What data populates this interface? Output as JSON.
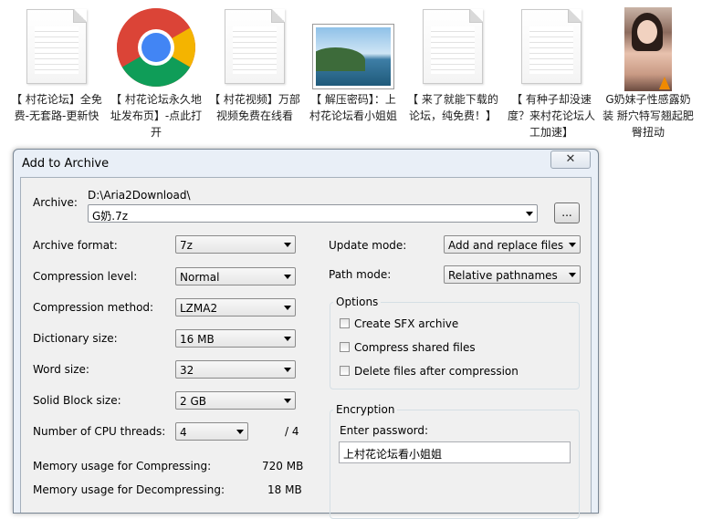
{
  "desktop": {
    "icons": [
      {
        "label": "【 村花论坛】全免费-无套路-更新快",
        "icon": "text-file-icon"
      },
      {
        "label": "【 村花论坛永久地址发布页】-点此打开",
        "icon": "chrome-icon"
      },
      {
        "label": "【 村花视频】万部视频免费在线看",
        "icon": "text-file-icon"
      },
      {
        "label": "【 解压密码】：上村花论坛看小姐姐",
        "icon": "image-file-icon"
      },
      {
        "label": "【 来了就能下载的论坛，纯免费！】",
        "icon": "text-file-icon"
      },
      {
        "label": "【 有种子却没速度？来村花论坛人工加速】",
        "icon": "text-file-icon"
      },
      {
        "label": "G奶妹子性感露奶装 掰穴特写翘起肥臀扭动",
        "icon": "video-file-icon"
      }
    ]
  },
  "dialog": {
    "title": "Add to Archive",
    "close_symbol": "✕",
    "archive_label": "Archive:",
    "archive_path": "D:\\Aria2Download\\",
    "archive_name": "G奶.7z",
    "browse_label": "...",
    "left": {
      "archive_format": {
        "label": "Archive format:",
        "value": "7z"
      },
      "compression_level": {
        "label": "Compression level:",
        "value": "Normal"
      },
      "compression_method": {
        "label": "Compression method:",
        "value": "LZMA2"
      },
      "dictionary_size": {
        "label": "Dictionary size:",
        "value": "16 MB"
      },
      "word_size": {
        "label": "Word size:",
        "value": "32"
      },
      "solid_block_size": {
        "label": "Solid Block size:",
        "value": "2 GB"
      },
      "cpu_threads": {
        "label": "Number of CPU threads:",
        "value": "4",
        "max": "/ 4"
      },
      "mem_compress": {
        "label": "Memory usage for Compressing:",
        "value": "720 MB"
      },
      "mem_decompress": {
        "label": "Memory usage for Decompressing:",
        "value": "18 MB"
      }
    },
    "right": {
      "update_mode": {
        "label": "Update mode:",
        "value": "Add and replace files"
      },
      "path_mode": {
        "label": "Path mode:",
        "value": "Relative pathnames"
      },
      "options": {
        "title": "Options",
        "create_sfx": "Create SFX archive",
        "compress_shared": "Compress shared files",
        "delete_after": "Delete files after compression"
      },
      "encryption": {
        "title": "Encryption",
        "enter_password_label": "Enter password:",
        "password_value": "上村花论坛看小姐姐"
      }
    }
  }
}
